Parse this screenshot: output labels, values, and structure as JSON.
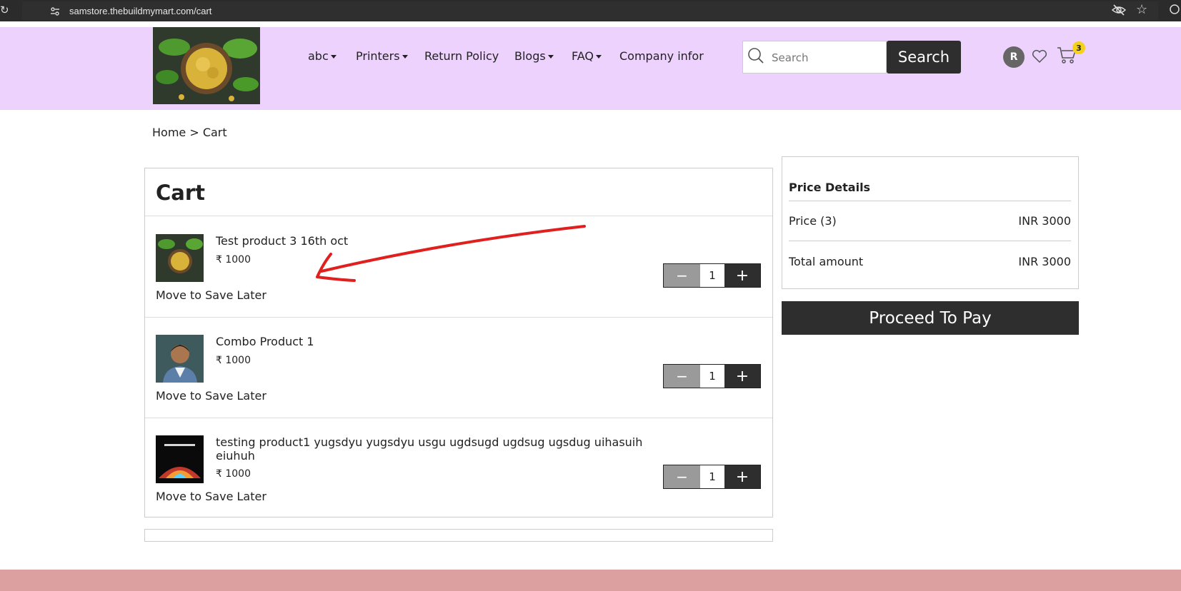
{
  "browser": {
    "url": "samstore.thebuildmymart.com/cart"
  },
  "header": {
    "nav": [
      {
        "label": "abc",
        "dropdown": true
      },
      {
        "label": "Printers",
        "dropdown": true
      },
      {
        "label": "Return Policy",
        "dropdown": false
      },
      {
        "label": "Blogs",
        "dropdown": true
      },
      {
        "label": "FAQ",
        "dropdown": true
      },
      {
        "label": "Company infor",
        "dropdown": false
      }
    ],
    "search": {
      "placeholder": "Search",
      "button_label": "Search"
    },
    "user_initial": "R",
    "cart_count": "3"
  },
  "breadcrumb": "Home > Cart",
  "cart": {
    "title": "Cart",
    "items": [
      {
        "name": "Test product 3 16th oct",
        "price": "₹ 1000",
        "save_later": "Move to Save Later",
        "qty": "1",
        "thumb": "fenugreek-seeds-image"
      },
      {
        "name": "Combo Product 1",
        "price": "₹ 1000",
        "save_later": "Move to Save Later",
        "qty": "1",
        "thumb": "man-portrait-image"
      },
      {
        "name": "testing product1 yugsdyu yugsdyu usgu ugdsugd ugdsug ugsdug uihasuih eiuhuh",
        "price": "₹ 1000",
        "save_later": "Move to Save Later",
        "qty": "1",
        "thumb": "printer-performance-image"
      }
    ],
    "minus_symbol": "−",
    "plus_symbol": "+"
  },
  "price_details": {
    "heading": "Price Details",
    "price_label": "Price (3)",
    "price_value": "INR 3000",
    "total_label": "Total amount",
    "total_value": "INR 3000"
  },
  "pay_button": "Proceed To Pay",
  "colors": {
    "header_bg": "#eed2fe",
    "dark_button": "#2e2e2e",
    "badge": "#f4d11b",
    "annotation": "#e01f1f",
    "footer_bg": "#dda0a0"
  }
}
